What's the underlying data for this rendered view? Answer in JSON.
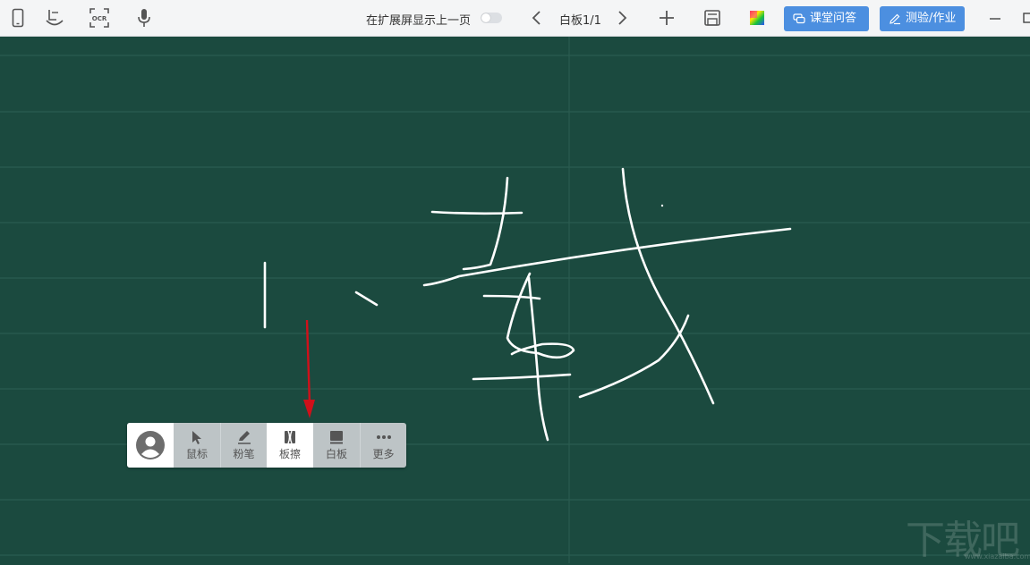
{
  "toolbar": {
    "icons": [
      "phone-icon",
      "projector-icon",
      "ocr-icon",
      "microphone-icon"
    ],
    "ocr_label": "OCR",
    "extend_label": "在扩展屏显示上一页",
    "page_indicator": "白板1/1",
    "qa_button": "课堂问答",
    "quiz_button": "测验/作业"
  },
  "palette": {
    "items": [
      {
        "icon": "cursor-icon",
        "label": "鼠标"
      },
      {
        "icon": "chalk-icon",
        "label": "粉笔"
      },
      {
        "icon": "eraser-icon",
        "label": "板擦",
        "active": true
      },
      {
        "icon": "whiteboard-icon",
        "label": "白板"
      },
      {
        "icon": "more-icon",
        "label": "更多"
      }
    ]
  },
  "watermark": {
    "text": "下载吧",
    "url": "www.xiazaiba.com"
  },
  "colors": {
    "board": "#1b4a3f",
    "grid": "#2b5c50",
    "accent": "#4c8fe0",
    "annotation_arrow": "#d0101a"
  }
}
